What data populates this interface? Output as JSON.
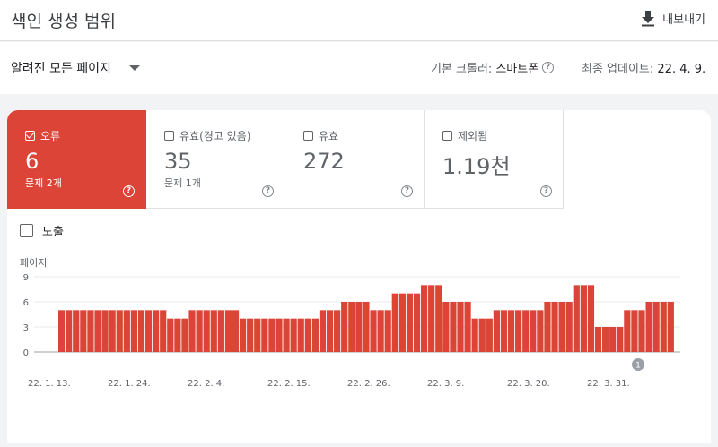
{
  "header": {
    "title": "색인 생성 범위",
    "export_label": "내보내기"
  },
  "toolbar": {
    "filter_label": "알려진 모든 페이지",
    "crawler_label": "기본 크롤러:",
    "crawler_value": "스마트폰",
    "updated_label": "최종 업데이트:",
    "updated_value": "22. 4. 9."
  },
  "tiles": [
    {
      "label": "오류",
      "value": "6",
      "sub": "문제 2개",
      "active": true
    },
    {
      "label": "유효(경고 있음)",
      "value": "35",
      "sub": "문제 1개",
      "active": false
    },
    {
      "label": "유효",
      "value": "272",
      "sub": "",
      "active": false
    },
    {
      "label": "제외됨",
      "value": "1.19천",
      "sub": "",
      "active": false
    }
  ],
  "impressions_label": "노출",
  "colors": {
    "error": "#db4437"
  },
  "chart_data": {
    "type": "bar",
    "ylabel": "페이지",
    "ylim": [
      0,
      9
    ],
    "yticks": [
      0,
      3,
      6,
      9
    ],
    "x_tick_labels": [
      "22. 1. 13.",
      "22. 1. 24.",
      "22. 2. 4.",
      "22. 2. 15.",
      "22. 2. 26.",
      "22. 3. 9.",
      "22. 3. 20.",
      "22. 3. 31."
    ],
    "annotation": "1",
    "values": [
      5,
      5,
      5,
      5,
      5,
      5,
      5,
      5,
      5,
      5,
      5,
      5,
      5,
      5,
      5,
      4,
      4,
      4,
      5,
      5,
      5,
      5,
      5,
      5,
      5,
      4,
      4,
      4,
      4,
      4,
      4,
      4,
      4,
      4,
      4,
      4,
      5,
      5,
      5,
      6,
      6,
      6,
      6,
      5,
      5,
      5,
      7,
      7,
      7,
      7,
      8,
      8,
      8,
      6,
      6,
      6,
      6,
      4,
      4,
      4,
      5,
      5,
      5,
      5,
      5,
      5,
      5,
      6,
      6,
      6,
      6,
      8,
      8,
      8,
      3,
      3,
      3,
      3,
      5,
      5,
      5,
      6,
      6,
      6,
      6
    ]
  }
}
